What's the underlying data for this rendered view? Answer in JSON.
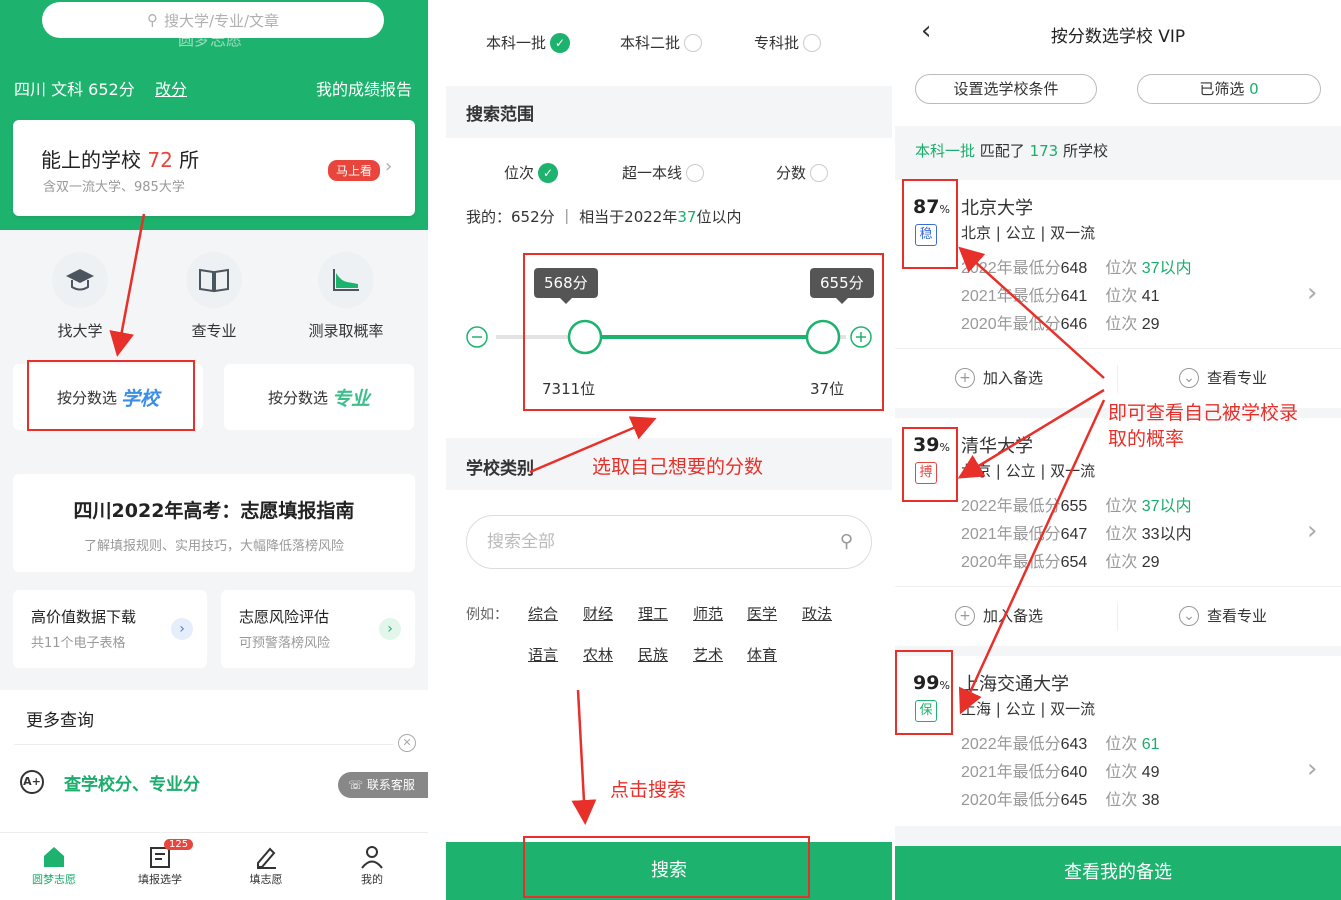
{
  "panel1": {
    "search_placeholder": "搜大学/专业/文章",
    "watermark": "圆梦志愿",
    "score_line": "四川 文科 652分",
    "change_link": "改分",
    "report_link": "我的成绩报告",
    "card": {
      "title_pre": "能上的学校",
      "count": "72",
      "title_post": "所",
      "subtitle": "含双一流大学、985大学",
      "button": "马上看"
    },
    "quick": [
      {
        "label": "找大学",
        "icon": "graduation-cap-icon"
      },
      {
        "label": "查专业",
        "icon": "book-icon"
      },
      {
        "label": "测录取概率",
        "icon": "chart-area-icon"
      }
    ],
    "select_school": {
      "pre": "按分数选",
      "big": "学校"
    },
    "select_major": {
      "pre": "按分数选",
      "big": "专业"
    },
    "guide": {
      "title": "四川2022年高考：志愿填报指南",
      "subtitle": "了解填报规则、实用技巧，大幅降低落榜风险"
    },
    "mini": [
      {
        "title": "高价值数据下载",
        "sub": "共11个电子表格"
      },
      {
        "title": "志愿风险评估",
        "sub": "可预警落榜风险"
      }
    ],
    "more": {
      "title": "更多查询",
      "row": "查学校分、专业分",
      "service": "联系客服"
    },
    "tabs": [
      {
        "label": "圆梦志愿",
        "icon": "home-icon"
      },
      {
        "label": "填报选学",
        "icon": "document-icon",
        "badge": "125"
      },
      {
        "label": "填志愿",
        "icon": "pen-icon"
      },
      {
        "label": "我的",
        "icon": "user-icon"
      }
    ]
  },
  "panel2": {
    "batches": [
      {
        "label": "本科一批",
        "checked": true
      },
      {
        "label": "本科二批",
        "checked": false
      },
      {
        "label": "专科批",
        "checked": false
      }
    ],
    "range_title": "搜索范围",
    "range_opts": [
      {
        "label": "位次",
        "checked": true
      },
      {
        "label": "超一本线",
        "checked": false
      },
      {
        "label": "分数",
        "checked": false
      }
    ],
    "mine_pre": "我的：652分 ｜ 相当于2022年",
    "mine_rank": "37",
    "mine_post": "位以内",
    "slider": {
      "low_score": "568分",
      "high_score": "655分",
      "low_rank": "7311位",
      "high_rank": "37位"
    },
    "type_title": "学校类别",
    "search_placeholder": "搜索全部",
    "example_label": "例如：",
    "tags_row1": [
      "综合",
      "财经",
      "理工",
      "师范",
      "医学",
      "政法"
    ],
    "tags_row2": [
      "语言",
      "农林",
      "民族",
      "艺术",
      "体育"
    ],
    "search_button": "搜索"
  },
  "panel3": {
    "title": "按分数选学校 VIP",
    "set_conditions": "设置选学校条件",
    "filtered_label": "已筛选",
    "filtered_count": "0",
    "match": {
      "batch": "本科一批",
      "pre": "匹配了",
      "count": "173",
      "post": "所学校"
    },
    "schools": [
      {
        "pct": "87",
        "level": "稳",
        "name": "北京大学",
        "meta": "北京 | 公立 | 双一流",
        "rows": [
          {
            "year": "2022年最低分",
            "score": "648",
            "rank_label": "位次",
            "rank": "37以内",
            "green": true
          },
          {
            "year": "2021年最低分",
            "score": "641",
            "rank_label": "位次",
            "rank": "41",
            "green": false
          },
          {
            "year": "2020年最低分",
            "score": "646",
            "rank_label": "位次",
            "rank": "29",
            "green": false
          }
        ]
      },
      {
        "pct": "39",
        "level": "搏",
        "name": "清华大学",
        "meta": "北京 | 公立 | 双一流",
        "rows": [
          {
            "year": "2022年最低分",
            "score": "655",
            "rank_label": "位次",
            "rank": "37以内",
            "green": true
          },
          {
            "year": "2021年最低分",
            "score": "647",
            "rank_label": "位次",
            "rank": "33以内",
            "green": false
          },
          {
            "year": "2020年最低分",
            "score": "654",
            "rank_label": "位次",
            "rank": "29",
            "green": false
          }
        ]
      },
      {
        "pct": "99",
        "level": "保",
        "name": "上海交通大学",
        "meta": "上海 | 公立 | 双一流",
        "rows": [
          {
            "year": "2022年最低分",
            "score": "643",
            "rank_label": "位次",
            "rank": "61",
            "green": true
          },
          {
            "year": "2021年最低分",
            "score": "640",
            "rank_label": "位次",
            "rank": "49",
            "green": false
          },
          {
            "year": "2020年最低分",
            "score": "645",
            "rank_label": "位次",
            "rank": "38",
            "green": false
          }
        ]
      }
    ],
    "add_fav": "加入备选",
    "view_major": "查看专业",
    "fav_button": "查看我的备选"
  },
  "annotations": {
    "pick_score": "选取自己想要的分数",
    "click_search": "点击搜索",
    "view_prob_1": "即可查看自己被学校录",
    "view_prob_2": "取的概率"
  },
  "colors": {
    "brand_green": "#1db36e",
    "annotation_red": "#e8302a",
    "badge_red": "#e8453c"
  }
}
